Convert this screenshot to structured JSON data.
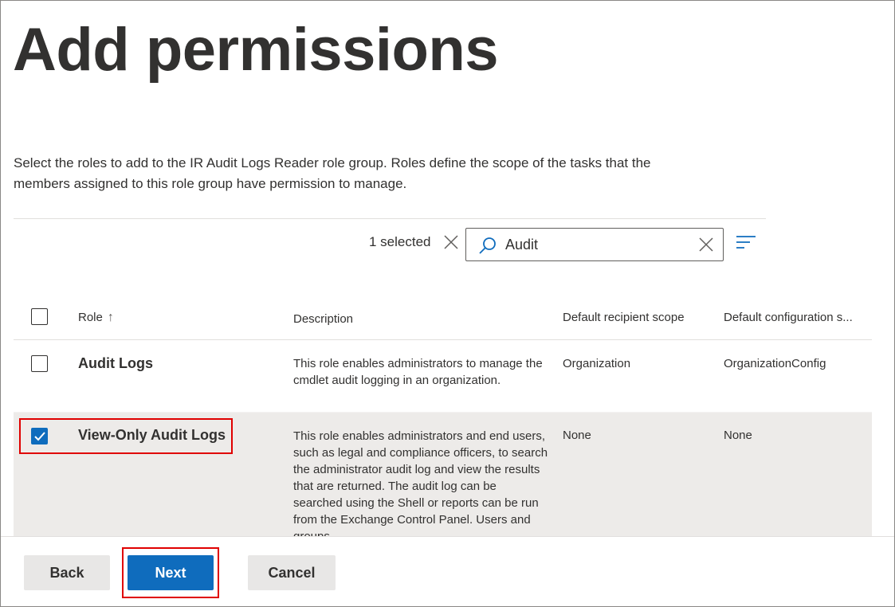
{
  "page": {
    "title": "Add permissions",
    "description": "Select the roles to add to the IR Audit Logs Reader role group. Roles define the scope of the tasks that the members assigned to this role group have permission to manage."
  },
  "toolbar": {
    "selected_text": "1 selected",
    "search_value": "Audit",
    "icons": {
      "clear_selection": "close-icon",
      "search": "search-icon",
      "clear_search": "close-icon",
      "filter": "filter-lines-icon"
    }
  },
  "table": {
    "headers": {
      "role": "Role",
      "description": "Description",
      "recipient_scope": "Default recipient scope",
      "config_scope": "Default configuration s..."
    },
    "sort_indicator": "↑",
    "rows": [
      {
        "role": "Audit Logs",
        "description": "This role enables administrators to manage the cmdlet audit logging in an organization.",
        "recipient_scope": "Organization",
        "config_scope": "OrganizationConfig",
        "selected": false
      },
      {
        "role": "View-Only Audit Logs",
        "description": "This role enables administrators and end users, such as legal and compliance officers, to search the administrator audit log and view the results that are returned. The audit log can be searched using the Shell or reports can be run from the Exchange Control Panel. Users and groups",
        "recipient_scope": "None",
        "config_scope": "None",
        "selected": true
      }
    ]
  },
  "footer": {
    "back_label": "Back",
    "next_label": "Next",
    "cancel_label": "Cancel"
  },
  "colors": {
    "accent": "#0f6cbd",
    "selected_row": "#edebe9",
    "highlight_box": "#e00000"
  }
}
